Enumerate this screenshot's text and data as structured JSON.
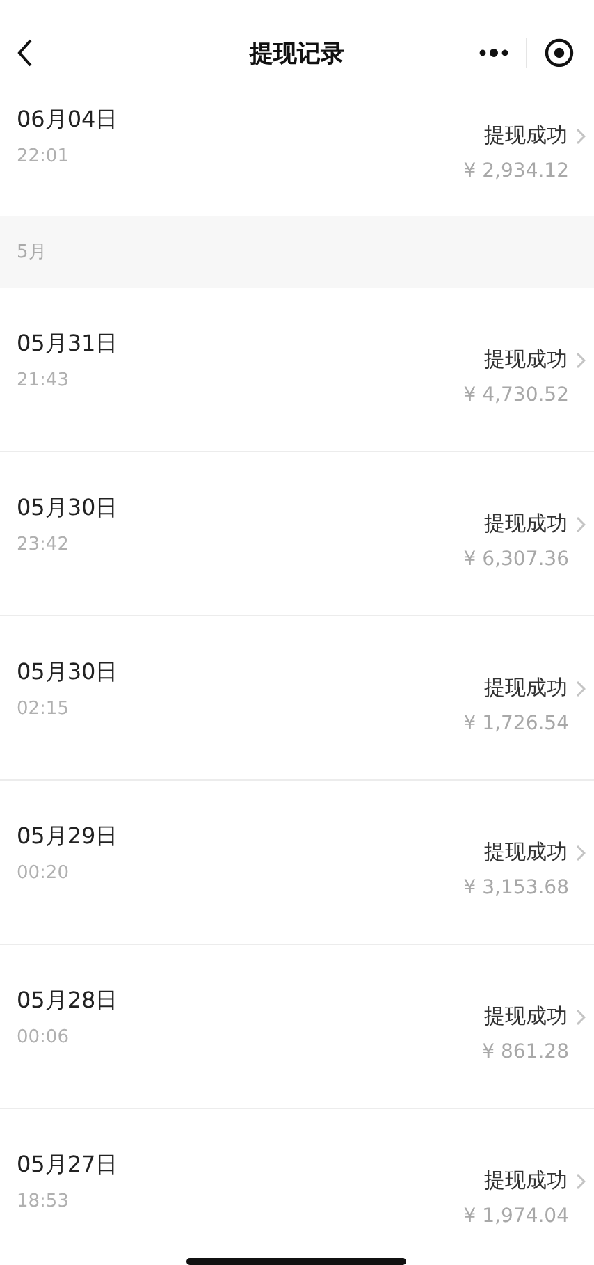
{
  "nav": {
    "title": "提现记录"
  },
  "sections": [
    {
      "records": [
        {
          "date": "06月04日",
          "time": "22:01",
          "status": "提现成功",
          "amount": "¥ 2,934.12"
        }
      ]
    },
    {
      "header": "5月",
      "records": [
        {
          "date": "05月31日",
          "time": "21:43",
          "status": "提现成功",
          "amount": "¥ 4,730.52"
        },
        {
          "date": "05月30日",
          "time": "23:42",
          "status": "提现成功",
          "amount": "¥ 6,307.36"
        },
        {
          "date": "05月30日",
          "time": "02:15",
          "status": "提现成功",
          "amount": "¥ 1,726.54"
        },
        {
          "date": "05月29日",
          "time": "00:20",
          "status": "提现成功",
          "amount": "¥ 3,153.68"
        },
        {
          "date": "05月28日",
          "time": "00:06",
          "status": "提现成功",
          "amount": "¥ 861.28"
        },
        {
          "date": "05月27日",
          "time": "18:53",
          "status": "提现成功",
          "amount": "¥ 1,974.04"
        }
      ]
    }
  ]
}
